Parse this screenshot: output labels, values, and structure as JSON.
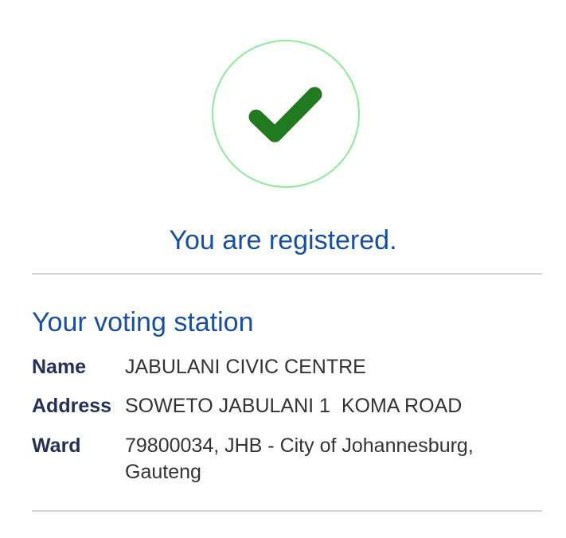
{
  "status": {
    "icon": "check-icon",
    "message": "You are registered.",
    "circle_color": "#8fe89b",
    "check_color": "#217a1f"
  },
  "voting_station": {
    "title": "Your voting station",
    "rows": [
      {
        "label": "Name",
        "value": "JABULANI CIVIC CENTRE"
      },
      {
        "label": "Address",
        "value": "SOWETO JABULANI 1  KOMA ROAD"
      },
      {
        "label": "Ward",
        "value": "79800034, JHB - City of Johannesburg, Gauteng"
      }
    ]
  },
  "colors": {
    "accent_text": "#1a4fa0",
    "label_text": "#243155",
    "divider": "#d4d4d4"
  }
}
